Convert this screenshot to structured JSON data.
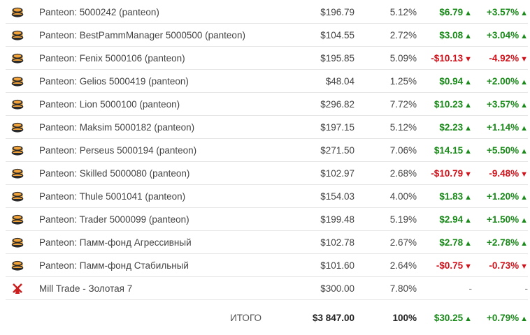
{
  "rows": [
    {
      "icon": "panteon-coin-icon",
      "name": "Panteon: 5000242 (panteon)",
      "value": "$196.79",
      "share": "5.12%",
      "profit": "$6.79",
      "profit_dir": "up",
      "pct": "+3.57%",
      "pct_dir": "up"
    },
    {
      "icon": "panteon-coin-icon",
      "name": "Panteon: BestPammManager 5000500 (panteon)",
      "value": "$104.55",
      "share": "2.72%",
      "profit": "$3.08",
      "profit_dir": "up",
      "pct": "+3.04%",
      "pct_dir": "up"
    },
    {
      "icon": "panteon-coin-icon",
      "name": "Panteon: Fenix 5000106 (panteon)",
      "value": "$195.85",
      "share": "5.09%",
      "profit": "-$10.13",
      "profit_dir": "down",
      "pct": "-4.92%",
      "pct_dir": "down"
    },
    {
      "icon": "panteon-coin-icon",
      "name": "Panteon: Gelios 5000419 (panteon)",
      "value": "$48.04",
      "share": "1.25%",
      "profit": "$0.94",
      "profit_dir": "up",
      "pct": "+2.00%",
      "pct_dir": "up"
    },
    {
      "icon": "panteon-coin-icon",
      "name": "Panteon: Lion 5000100 (panteon)",
      "value": "$296.82",
      "share": "7.72%",
      "profit": "$10.23",
      "profit_dir": "up",
      "pct": "+3.57%",
      "pct_dir": "up"
    },
    {
      "icon": "panteon-coin-icon",
      "name": "Panteon: Maksim 5000182 (panteon)",
      "value": "$197.15",
      "share": "5.12%",
      "profit": "$2.23",
      "profit_dir": "up",
      "pct": "+1.14%",
      "pct_dir": "up"
    },
    {
      "icon": "panteon-coin-icon",
      "name": "Panteon: Perseus 5000194 (panteon)",
      "value": "$271.50",
      "share": "7.06%",
      "profit": "$14.15",
      "profit_dir": "up",
      "pct": "+5.50%",
      "pct_dir": "up"
    },
    {
      "icon": "panteon-coin-icon",
      "name": "Panteon: Skilled 5000080 (panteon)",
      "value": "$102.97",
      "share": "2.68%",
      "profit": "-$10.79",
      "profit_dir": "down",
      "pct": "-9.48%",
      "pct_dir": "down"
    },
    {
      "icon": "panteon-coin-icon",
      "name": "Panteon: Thule 5001041 (panteon)",
      "value": "$154.03",
      "share": "4.00%",
      "profit": "$1.83",
      "profit_dir": "up",
      "pct": "+1.20%",
      "pct_dir": "up"
    },
    {
      "icon": "panteon-coin-icon",
      "name": "Panteon: Trader 5000099 (panteon)",
      "value": "$199.48",
      "share": "5.19%",
      "profit": "$2.94",
      "profit_dir": "up",
      "pct": "+1.50%",
      "pct_dir": "up"
    },
    {
      "icon": "panteon-coin-icon",
      "name": "Panteon: Памм-фонд Агрессивный",
      "value": "$102.78",
      "share": "2.67%",
      "profit": "$2.78",
      "profit_dir": "up",
      "pct": "+2.78%",
      "pct_dir": "up"
    },
    {
      "icon": "panteon-coin-icon",
      "name": "Panteon: Памм-фонд Стабильный",
      "value": "$101.60",
      "share": "2.64%",
      "profit": "-$0.75",
      "profit_dir": "down",
      "pct": "-0.73%",
      "pct_dir": "down"
    },
    {
      "icon": "windmill-icon",
      "name": "Mill Trade - Золотая 7",
      "value": "$300.00",
      "share": "7.80%",
      "profit": "-",
      "profit_dir": "none",
      "pct": "-",
      "pct_dir": "none"
    }
  ],
  "total": {
    "label": "ИТОГО",
    "value": "$3 847.00",
    "share": "100%",
    "profit": "$30.25",
    "profit_dir": "up",
    "pct": "+0.79%",
    "pct_dir": "up"
  },
  "colors": {
    "positive": "#1a8a1a",
    "negative": "#d0121b",
    "coin_orange": "#f2a33a",
    "coin_dark": "#2b2b2b",
    "windmill_red": "#cc1f1f"
  }
}
